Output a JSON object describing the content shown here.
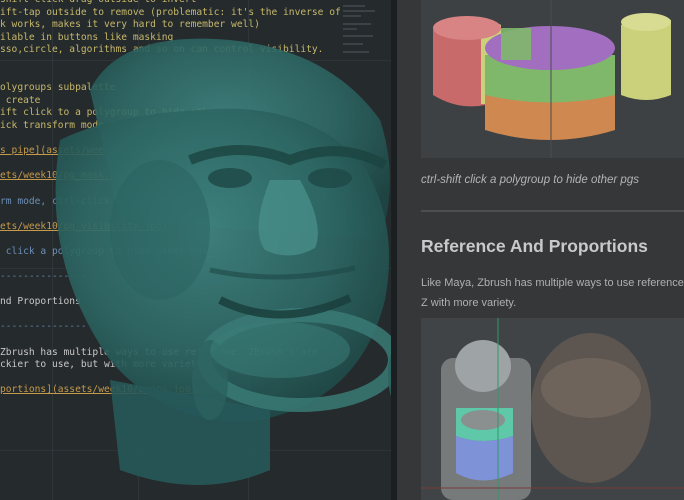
{
  "editor": {
    "lines": [
      {
        "text": "shift-click drag outside to invert",
        "cls": "c-yellow"
      },
      {
        "text": "ift-tap outside to remove (problematic: it's the inverse of",
        "cls": "c-yellow"
      },
      {
        "text": "k works, makes it very hard to remember well)",
        "cls": "c-yellow"
      },
      {
        "text": "ilable in buttons like masking",
        "cls": "c-yellow"
      },
      {
        "text": "sso,circle, algorithms and so on can control visibility.",
        "cls": "c-yellow"
      },
      {
        "text": "",
        "cls": ""
      },
      {
        "text": "",
        "cls": ""
      },
      {
        "text": "olygroups subpalette",
        "cls": "c-yellow"
      },
      {
        "text": " create",
        "cls": "c-yellow"
      },
      {
        "text": "ift click to a polygroup to hide others",
        "cls": "c-yellow"
      },
      {
        "text": "ick transform mode to mask all other pgs",
        "cls": "c-yellow"
      },
      {
        "text": "",
        "cls": ""
      },
      {
        "text": "s pipe](assets/week10/pg_pipe.jpg)",
        "cls": "c-link"
      },
      {
        "text": "",
        "cls": ""
      },
      {
        "text": "ets/week10/pg_mask.jpg)",
        "cls": "c-link"
      },
      {
        "text": "",
        "cls": ""
      },
      {
        "text": "rm mode, ctrl-click a polygroup to mask everything else_",
        "cls": "c-blue"
      },
      {
        "text": "",
        "cls": ""
      },
      {
        "text": "ets/week10/pg_visibility.jpg)",
        "cls": "c-link"
      },
      {
        "text": "",
        "cls": ""
      },
      {
        "text": " click a polygroup to hide other pgs_",
        "cls": "c-blue"
      },
      {
        "text": "",
        "cls": ""
      },
      {
        "text": "---------------",
        "cls": "c-dash"
      },
      {
        "text": "",
        "cls": ""
      },
      {
        "text": "nd Proportions",
        "cls": "c-white"
      },
      {
        "text": "",
        "cls": ""
      },
      {
        "text": "---------------",
        "cls": "c-dash"
      },
      {
        "text": "",
        "cls": ""
      },
      {
        "text": "Zbrush has multiple ways to use reference. ZBrush's are",
        "cls": "c-white"
      },
      {
        "text": "ckier to use, but with more variety.",
        "cls": "c-white"
      },
      {
        "text": "",
        "cls": ""
      },
      {
        "text": "portions](assets/week10/props.jpg)",
        "cls": "c-link"
      }
    ]
  },
  "preview": {
    "caption": "ctrl-shift click a polygroup to hide other pgs",
    "heading": "Reference And Proportions",
    "paragraph": "Like Maya, Zbrush has multiple ways to use reference. Z with more variety."
  },
  "colors": {
    "head": "#2f6b68",
    "pg_red": "#c96a6a",
    "pg_green": "#7fb86a",
    "pg_purple": "#a16ec0",
    "pg_orange": "#cf8850",
    "pg_yellow": "#cbd07a"
  }
}
